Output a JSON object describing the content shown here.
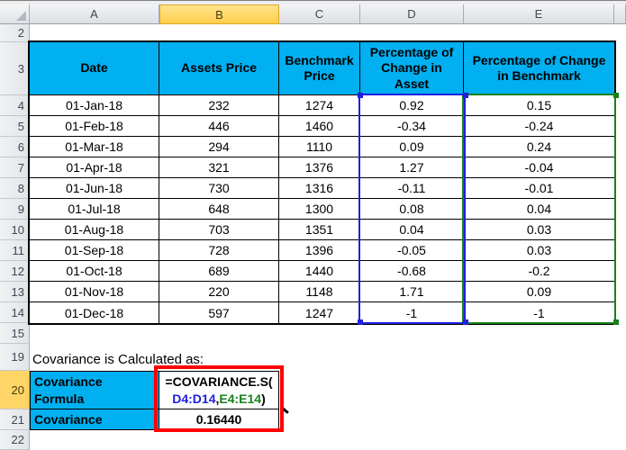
{
  "sheet": {
    "column_headers": [
      "A",
      "B",
      "C",
      "D",
      "E"
    ],
    "row_headers": [
      "2",
      "3",
      "4",
      "5",
      "6",
      "7",
      "8",
      "9",
      "10",
      "11",
      "12",
      "13",
      "14",
      "15",
      "19",
      "20",
      "21",
      "22"
    ],
    "selected_column": "B",
    "selected_row": "20"
  },
  "table": {
    "headers": [
      "Date",
      "Assets Price",
      "Benchmark Price",
      "Percentage of Change in Asset",
      "Percentage of Change in Benchmark"
    ],
    "rows": [
      {
        "date": "01-Jan-18",
        "assets": "232",
        "benchmark": "1274",
        "pct_asset": "0.92",
        "pct_benchmark": "0.15"
      },
      {
        "date": "01-Feb-18",
        "assets": "446",
        "benchmark": "1460",
        "pct_asset": "-0.34",
        "pct_benchmark": "-0.24"
      },
      {
        "date": "01-Mar-18",
        "assets": "294",
        "benchmark": "1110",
        "pct_asset": "0.09",
        "pct_benchmark": "0.24"
      },
      {
        "date": "01-Apr-18",
        "assets": "321",
        "benchmark": "1376",
        "pct_asset": "1.27",
        "pct_benchmark": "-0.04"
      },
      {
        "date": "01-Jun-18",
        "assets": "730",
        "benchmark": "1316",
        "pct_asset": "-0.11",
        "pct_benchmark": "-0.01"
      },
      {
        "date": "01-Jul-18",
        "assets": "648",
        "benchmark": "1300",
        "pct_asset": "0.08",
        "pct_benchmark": "0.04"
      },
      {
        "date": "01-Aug-18",
        "assets": "703",
        "benchmark": "1351",
        "pct_asset": "0.04",
        "pct_benchmark": "0.03"
      },
      {
        "date": "01-Sep-18",
        "assets": "728",
        "benchmark": "1396",
        "pct_asset": "-0.05",
        "pct_benchmark": "0.03"
      },
      {
        "date": "01-Oct-18",
        "assets": "689",
        "benchmark": "1440",
        "pct_asset": "-0.68",
        "pct_benchmark": "-0.2"
      },
      {
        "date": "01-Nov-18",
        "assets": "220",
        "benchmark": "1148",
        "pct_asset": "1.71",
        "pct_benchmark": "0.09"
      },
      {
        "date": "01-Dec-18",
        "assets": "597",
        "benchmark": "1247",
        "pct_asset": "-1",
        "pct_benchmark": "-1"
      }
    ]
  },
  "note": {
    "text": "Covariance is Calculated as:"
  },
  "formula_block": {
    "label_line1": "Covariance",
    "label_line2": "Formula",
    "prefix": "=COVARIANCE.S(",
    "range1": "D4:D14",
    "separator": ",",
    "range2": "E4:E14",
    "suffix": ")",
    "result_label": "Covariance",
    "result_value": "0.16440"
  },
  "selection": {
    "range1": "D4:D14",
    "range2": "E4:E14"
  },
  "colors": {
    "header_fill": "#00B0F0",
    "selected_header": "#FFD567",
    "range1_color": "#2020DF",
    "range2_color": "#17821C",
    "annotation_color": "#FE0000"
  }
}
